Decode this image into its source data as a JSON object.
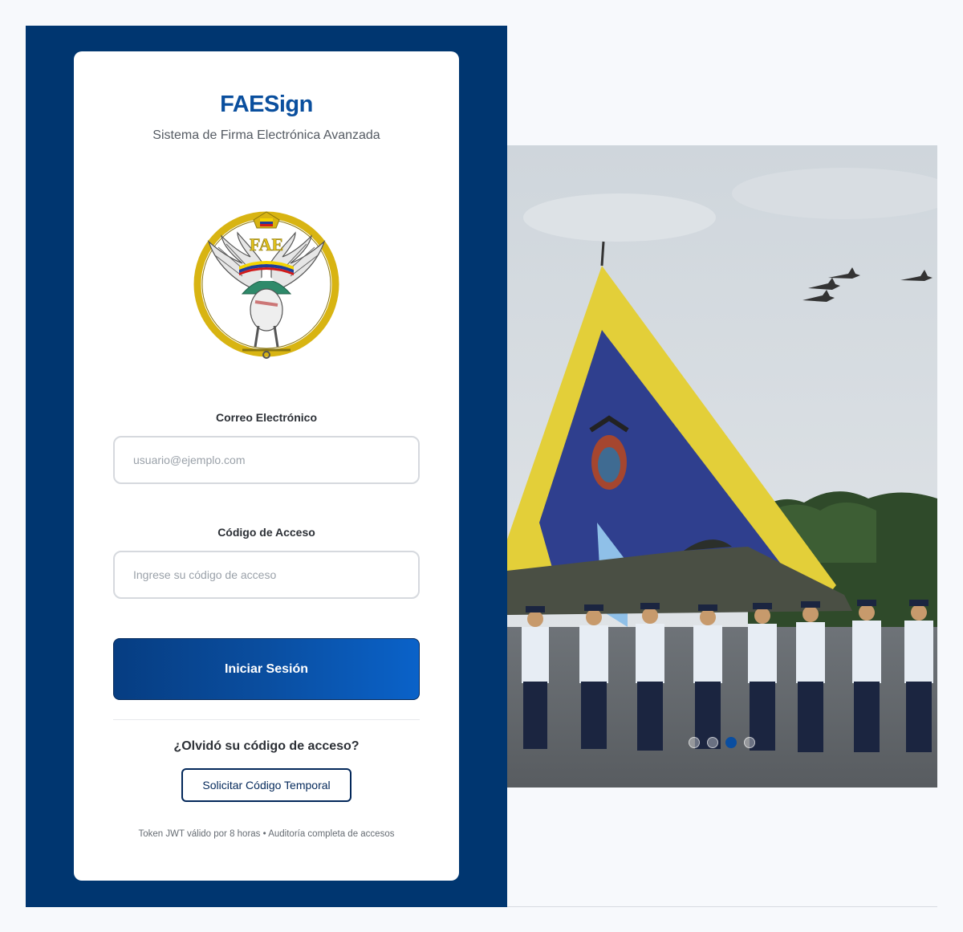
{
  "app": {
    "title": "FAESign",
    "subtitle": "Sistema de Firma Electrónica Avanzada"
  },
  "logo": {
    "text": "FAE",
    "icon": "fae-eagle-emblem"
  },
  "form": {
    "email_label": "Correo Electrónico",
    "email_placeholder": "usuario@ejemplo.com",
    "email_value": "",
    "code_label": "Código de Acceso",
    "code_placeholder": "Ingrese su código de acceso",
    "code_value": "",
    "submit_label": "Iniciar Sesión"
  },
  "recovery": {
    "question": "¿Olvidó su código de acceso?",
    "button_label": "Solicitar Código Temporal"
  },
  "footer": {
    "note": "Token JWT válido por 8 horas • Auditoría completa de accesos"
  },
  "carousel": {
    "slide_count": 4,
    "active_index": 2
  },
  "colors": {
    "panel_bg": "#003670",
    "brand_blue": "#0a4f9e",
    "button_start": "#063d82",
    "button_end": "#0a62c9"
  }
}
